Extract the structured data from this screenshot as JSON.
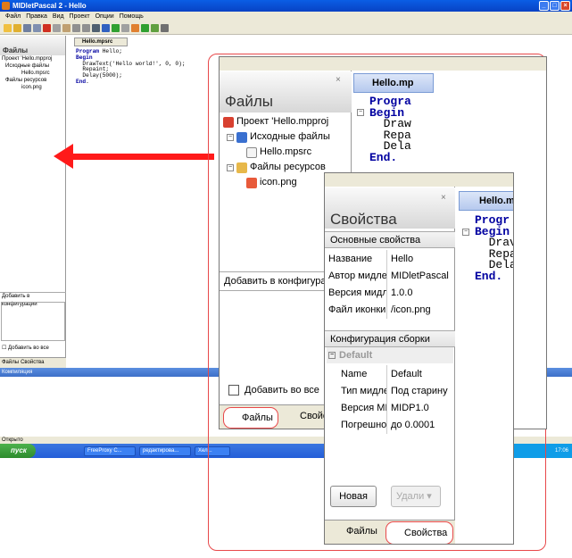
{
  "window": {
    "title": "MIDletPascal 2 - Hello"
  },
  "menu": [
    "Файл",
    "Правка",
    "Вид",
    "Проект",
    "Опции",
    "Помощь"
  ],
  "colors": {
    "titlebar": "#0842c4",
    "keyword": "#0000a0",
    "highlight": "#e8484a",
    "arrow": "#ff1a1a",
    "taskbar": "#245ed8"
  },
  "files_panel": {
    "title": "Файлы",
    "tree": [
      {
        "label": "Проект 'Hello.mpproj",
        "icon": "project-icon"
      },
      {
        "label": "Исходные файлы",
        "icon": "folder-icon"
      },
      {
        "label": "Hello.mpsrc",
        "icon": "file-icon"
      },
      {
        "label": "Файлы ресурсов",
        "icon": "folder-icon"
      },
      {
        "label": "icon.png",
        "icon": "image-icon"
      }
    ],
    "add_to_config": "Добавить в конфигурации",
    "add_to_config_short": "Добавить в конфигура",
    "add_to_all": "Добавить во все",
    "tabs": {
      "files": "Файлы",
      "props": "Свойства",
      "props_short": "Свойс"
    }
  },
  "editor": {
    "tab": "Hello.mpsrc",
    "tab_short": "Hello.mp",
    "tab_short2": "Hello.m",
    "code": [
      {
        "kw": "Program",
        "rest": " Hello;"
      },
      {
        "kw": "Begin",
        "rest": ""
      },
      {
        "kw": "",
        "rest": "  DrawText('Hello world!', 0, 0);"
      },
      {
        "kw": "",
        "rest": "  Repaint;"
      },
      {
        "kw": "",
        "rest": "  Delay(5000);"
      },
      {
        "kw": "End",
        "rest": "."
      }
    ],
    "code_zoom": [
      "Progra",
      "Begin",
      "Draw",
      "Repa",
      "Dela",
      "End."
    ],
    "code_zoom2": [
      "Progr",
      "Begin",
      "Drav",
      "Repa",
      "Dela",
      "End."
    ]
  },
  "properties": {
    "title": "Свойства",
    "basic_section": "Основные свойства",
    "basic": [
      {
        "key": "Название",
        "value": "Hello"
      },
      {
        "key": "Автор мидле",
        "value": "MIDletPascal"
      },
      {
        "key": "Версия мидле",
        "value": "1.0.0"
      },
      {
        "key": "Файл иконки",
        "value": "/icon.png"
      }
    ],
    "build_section": "Конфигурация сборки",
    "default_group": "Default",
    "build": [
      {
        "key": "Name",
        "value": "Default"
      },
      {
        "key": "Тип мидле",
        "value": "Под старину"
      },
      {
        "key": "Версия MI",
        "value": "MIDP1.0"
      },
      {
        "key": "Погрешно",
        "value": "до 0.0001"
      }
    ],
    "btn_new": "Новая",
    "btn_delete": "Удали"
  },
  "bottom": {
    "compile_label": "Компиляция",
    "status": "Открыто",
    "start": "пуск",
    "tasks": [
      "FreeProxy C...",
      "редактирова...",
      "Хел..."
    ],
    "clock": "17:06"
  }
}
